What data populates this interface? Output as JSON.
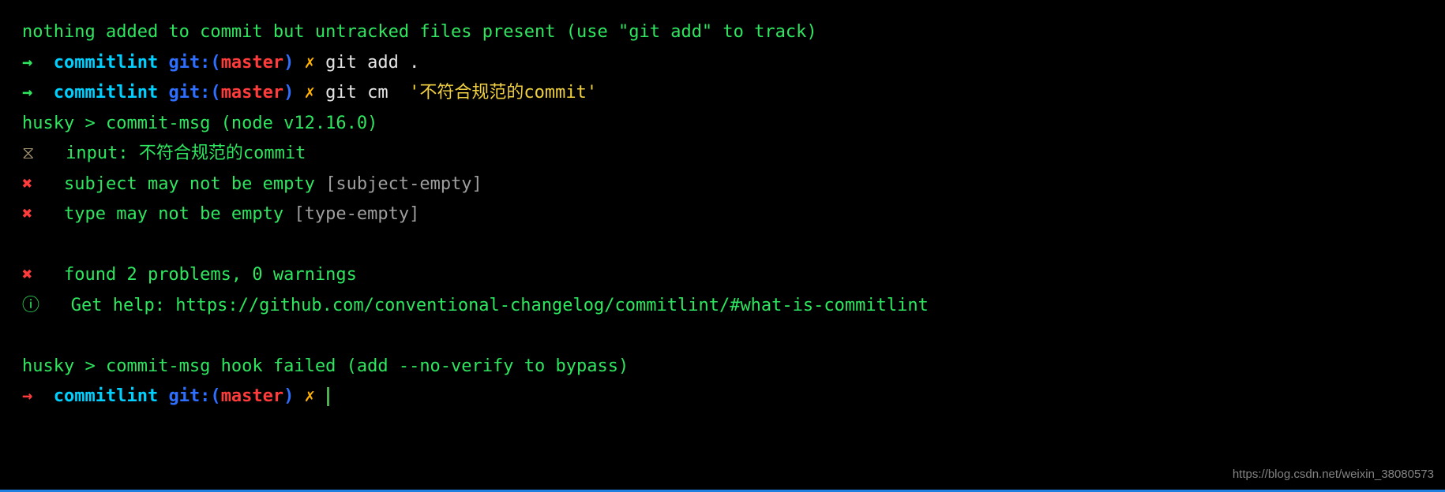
{
  "statusLine": "nothing added to commit but untracked files present (use \"git add\" to track)",
  "prompt": {
    "arrow": "→  ",
    "dir": "commitlint",
    "gitPrefix": " git:(",
    "branch": "master",
    "gitSuffix": ")",
    "dirty": " ✗ "
  },
  "cmd1": "git add .",
  "cmd2": "git cm  ",
  "cmd2arg": "'不符合规范的commit'",
  "husky1": "husky > commit-msg (node v12.16.0)",
  "sandIcon": "⧖   ",
  "inputLine": "input: 不符合规范的commit",
  "err1": {
    "cross": "✖   ",
    "msg": "subject may not be empty ",
    "rule": "[subject-empty]"
  },
  "err2": {
    "cross": "✖   ",
    "msg": "type may not be empty ",
    "rule": "[type-empty]"
  },
  "summary": {
    "cross": "✖   ",
    "msg": "found 2 problems, 0 warnings"
  },
  "help": {
    "icon": "ⓘ   ",
    "msg": "Get help: https://github.com/conventional-changelog/commitlint/#what-is-commitlint"
  },
  "husky2": "husky > commit-msg hook failed (add --no-verify to bypass)",
  "watermark": "https://blog.csdn.net/weixin_38080573"
}
